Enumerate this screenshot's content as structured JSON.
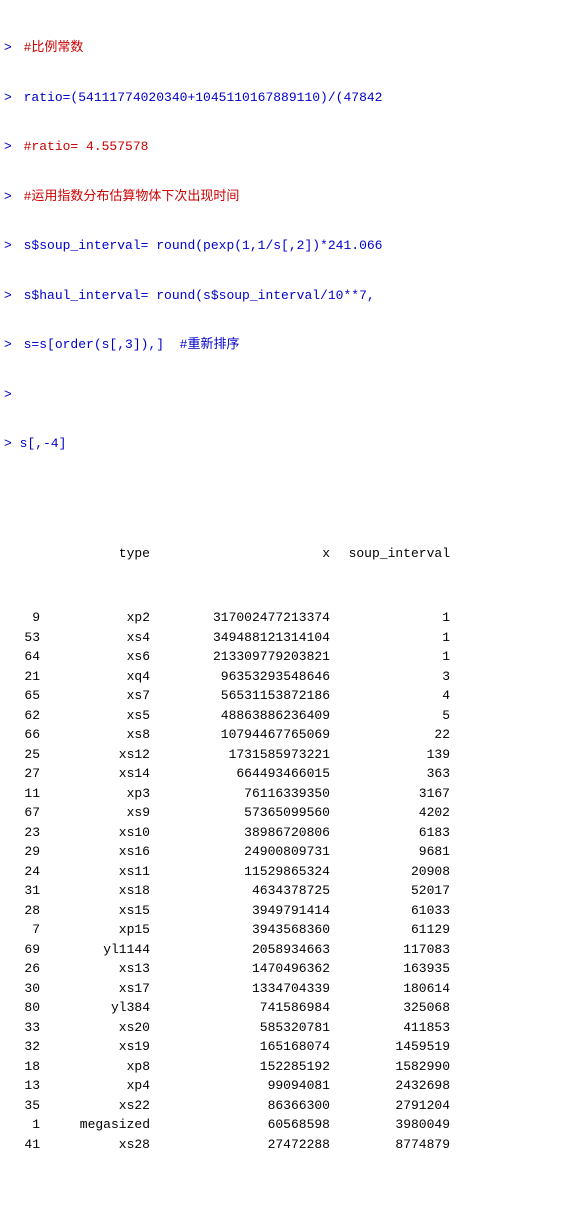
{
  "console": {
    "header_lines": [
      {
        "type": "comment",
        "prompt": ">",
        "text": " #比例常数"
      },
      {
        "type": "code",
        "prompt": ">",
        "text": " ratio=(54111774020340+1045110167889110)/(47842"
      },
      {
        "type": "comment",
        "prompt": ">",
        "text": " #ratio= 4.557578"
      },
      {
        "type": "comment",
        "prompt": ">",
        "text": " #运用指数分布估算物体下次出现时间"
      },
      {
        "type": "code",
        "prompt": ">",
        "text": " s$soup_interval= round(pexp(1,1/s[,2])*241.066"
      },
      {
        "type": "code",
        "prompt": ">",
        "text": " s$haul_interval= round(s$soup_interval/10**7,"
      },
      {
        "type": "code",
        "prompt": ">",
        "text": " s=s[order(s[,3]),]  #重新排序"
      }
    ],
    "empty_prompt": ">",
    "command": "> s[,-4]",
    "table": {
      "headers": [
        "",
        "type",
        "x",
        "soup_interval"
      ],
      "rows": [
        {
          "num": "9",
          "type": "xp2",
          "x": "317002477213374",
          "soup": "1"
        },
        {
          "num": "53",
          "type": "xs4",
          "x": "349488121314104",
          "soup": "1"
        },
        {
          "num": "64",
          "type": "xs6",
          "x": "213309779203821",
          "soup": "1"
        },
        {
          "num": "21",
          "type": "xq4",
          "x": "96353293548646",
          "soup": "3"
        },
        {
          "num": "65",
          "type": "xs7",
          "x": "56531153872186",
          "soup": "4"
        },
        {
          "num": "62",
          "type": "xs5",
          "x": "48863886236409",
          "soup": "5"
        },
        {
          "num": "66",
          "type": "xs8",
          "x": "10794467765069",
          "soup": "22"
        },
        {
          "num": "25",
          "type": "xs12",
          "x": "1731585973221",
          "soup": "139"
        },
        {
          "num": "27",
          "type": "xs14",
          "x": "664493466015",
          "soup": "363"
        },
        {
          "num": "11",
          "type": "xp3",
          "x": "76116339350",
          "soup": "3167"
        },
        {
          "num": "67",
          "type": "xs9",
          "x": "57365099560",
          "soup": "4202"
        },
        {
          "num": "23",
          "type": "xs10",
          "x": "38986720806",
          "soup": "6183"
        },
        {
          "num": "29",
          "type": "xs16",
          "x": "24900809731",
          "soup": "9681"
        },
        {
          "num": "24",
          "type": "xs11",
          "x": "11529865324",
          "soup": "20908"
        },
        {
          "num": "31",
          "type": "xs18",
          "x": "4634378725",
          "soup": "52017"
        },
        {
          "num": "28",
          "type": "xs15",
          "x": "3949791414",
          "soup": "61033"
        },
        {
          "num": "7",
          "type": "xp15",
          "x": "3943568360",
          "soup": "61129"
        },
        {
          "num": "69",
          "type": "yl1144",
          "x": "2058934663",
          "soup": "117083"
        },
        {
          "num": "26",
          "type": "xs13",
          "x": "1470496362",
          "soup": "163935"
        },
        {
          "num": "30",
          "type": "xs17",
          "x": "1334704339",
          "soup": "180614"
        },
        {
          "num": "80",
          "type": "yl384",
          "x": "741586984",
          "soup": "325068"
        },
        {
          "num": "33",
          "type": "xs20",
          "x": "585320781",
          "soup": "411853"
        },
        {
          "num": "32",
          "type": "xs19",
          "x": "165168074",
          "soup": "1459519"
        },
        {
          "num": "18",
          "type": "xp8",
          "x": "152285192",
          "soup": "1582990"
        },
        {
          "num": "13",
          "type": "xp4",
          "x": "99094081",
          "soup": "2432698"
        },
        {
          "num": "35",
          "type": "xs22",
          "x": "86366300",
          "soup": "2791204"
        },
        {
          "num": "1",
          "type": "megasized",
          "x": "60568598",
          "soup": "3980049"
        },
        {
          "num": "41",
          "type": "xs28",
          "x": "27472288",
          "soup": "8774879"
        }
      ]
    }
  }
}
